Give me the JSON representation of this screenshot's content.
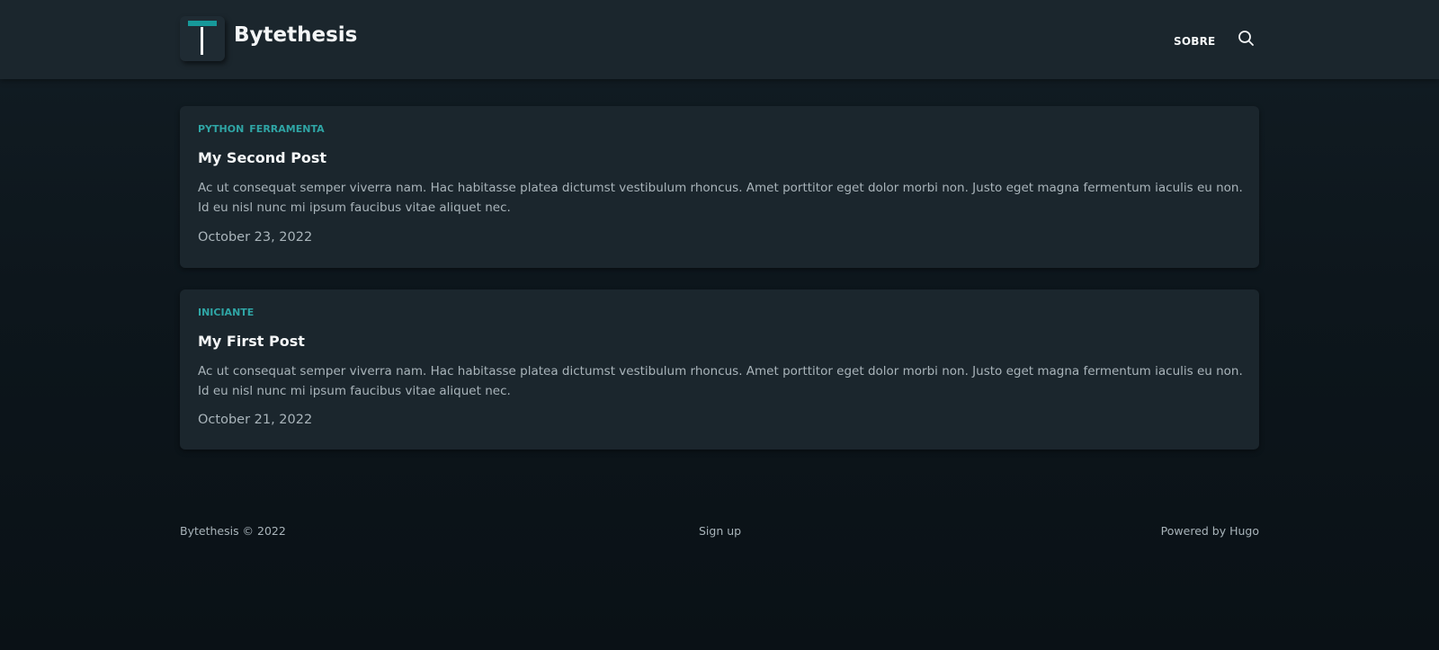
{
  "header": {
    "logo_letter": "T",
    "site_title": "Bytethesis",
    "nav": [
      {
        "label": "SOBRE"
      }
    ],
    "search_icon": "search-icon"
  },
  "posts": [
    {
      "tags": [
        "PYTHON",
        "FERRAMENTA"
      ],
      "title": "My Second Post",
      "excerpt": "Ac ut consequat semper viverra nam. Hac habitasse platea dictumst vestibulum rhoncus. Amet porttitor eget dolor morbi non. Justo eget magna fermentum iaculis eu non. Id eu nisl nunc mi ipsum faucibus vitae aliquet nec.",
      "date": "October 23, 2022"
    },
    {
      "tags": [
        "INICIANTE"
      ],
      "title": "My First Post",
      "excerpt": "Ac ut consequat semper viverra nam. Hac habitasse platea dictumst vestibulum rhoncus. Amet porttitor eget dolor morbi non. Justo eget magna fermentum iaculis eu non. Id eu nisl nunc mi ipsum faucibus vitae aliquet nec.",
      "date": "October 21, 2022"
    }
  ],
  "footer": {
    "copyright": "Bytethesis © 2022",
    "signup": "Sign up",
    "powered": "Powered by Hugo"
  },
  "colors": {
    "accent": "#17999a",
    "tag": "#2fa5a5",
    "card_bg": "#1b262d",
    "page_bg": "#0f191f",
    "muted_text": "#a9b4ba"
  }
}
